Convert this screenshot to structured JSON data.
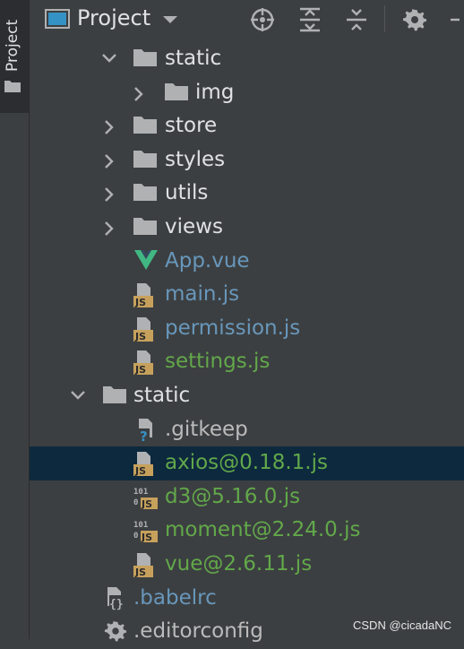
{
  "sidebar_tab": {
    "label": "Project"
  },
  "header": {
    "title": "Project"
  },
  "tree": {
    "rows": [
      {
        "label": "static",
        "kind": "folder",
        "expanded": true,
        "color": "#dfe1e5"
      },
      {
        "label": "img",
        "kind": "folder",
        "expanded": false,
        "color": "#dfe1e5"
      },
      {
        "label": "store",
        "kind": "folder",
        "expanded": false,
        "color": "#dfe1e5"
      },
      {
        "label": "styles",
        "kind": "folder",
        "expanded": false,
        "color": "#dfe1e5"
      },
      {
        "label": "utils",
        "kind": "folder",
        "expanded": false,
        "color": "#dfe1e5"
      },
      {
        "label": "views",
        "kind": "folder",
        "expanded": false,
        "color": "#dfe1e5"
      },
      {
        "label": "App.vue",
        "kind": "vue-file",
        "color": "#6897bb"
      },
      {
        "label": "main.js",
        "kind": "js-file",
        "color": "#6897bb"
      },
      {
        "label": "permission.js",
        "kind": "js-file",
        "color": "#6897bb"
      },
      {
        "label": "settings.js",
        "kind": "js-file",
        "color": "#62a84a"
      },
      {
        "label": "static",
        "kind": "folder",
        "expanded": true,
        "color": "#dfe1e5"
      },
      {
        "label": ".gitkeep",
        "kind": "unknown-file",
        "color": "#bbbbbb"
      },
      {
        "label": "axios@0.18.1.js",
        "kind": "js-file",
        "color": "#62a84a",
        "selected": true
      },
      {
        "label": "d3@5.16.0.js",
        "kind": "js-min-file",
        "color": "#62a84a"
      },
      {
        "label": "moment@2.24.0.js",
        "kind": "js-min-file",
        "color": "#62a84a"
      },
      {
        "label": "vue@2.6.11.js",
        "kind": "js-file",
        "color": "#62a84a"
      },
      {
        "label": ".babelrc",
        "kind": "json-config-file",
        "color": "#6897bb"
      },
      {
        "label": ".editorconfig",
        "kind": "config-file",
        "color": "#bbbbbb"
      }
    ]
  },
  "watermark": "CSDN @cicadaNC"
}
